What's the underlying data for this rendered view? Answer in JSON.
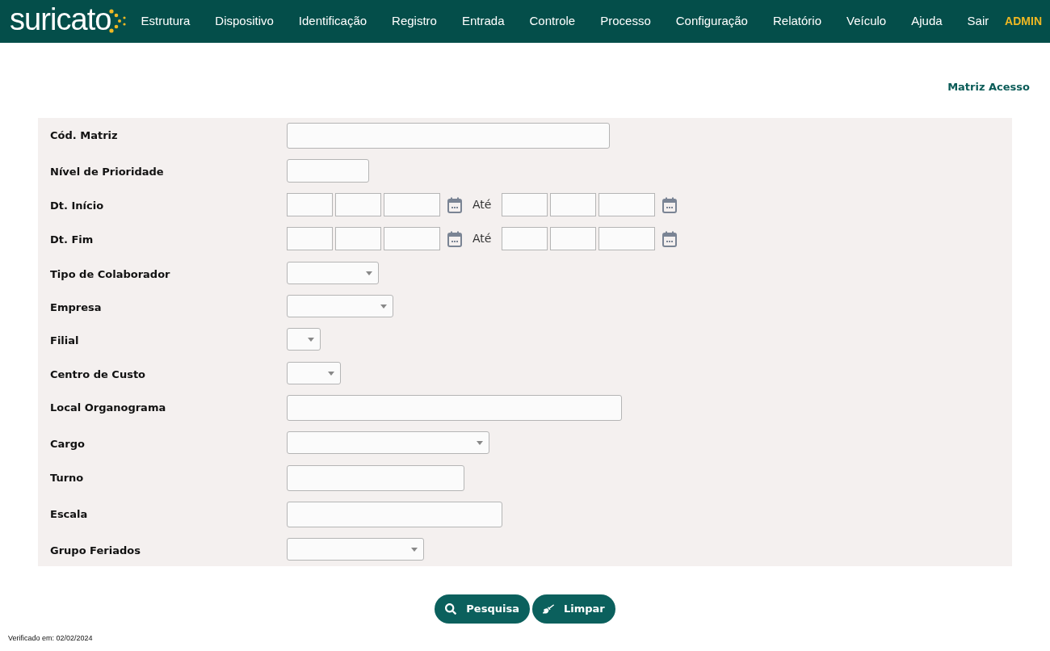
{
  "header": {
    "logo": "suricato",
    "menu": [
      {
        "label": "Estrutura"
      },
      {
        "label": "Dispositivo"
      },
      {
        "label": "Identificação"
      },
      {
        "label": "Registro"
      },
      {
        "label": "Entrada"
      },
      {
        "label": "Controle"
      },
      {
        "label": "Processo"
      },
      {
        "label": "Configuração"
      },
      {
        "label": "Relatório"
      },
      {
        "label": "Veículo"
      },
      {
        "label": "Ajuda"
      },
      {
        "label": "Sair"
      }
    ],
    "user": "ADMIN"
  },
  "page_title": "Matriz Acesso",
  "fields": [
    {
      "label": "Cód. Matriz",
      "kind": "text"
    },
    {
      "label": "Nível de Prioridade",
      "kind": "text"
    },
    {
      "label": "Dt. Início",
      "kind": "date_range",
      "separator": "Até"
    },
    {
      "label": "Dt. Fim",
      "kind": "date_range",
      "separator": "Até"
    },
    {
      "label": "Tipo de Colaborador",
      "kind": "select"
    },
    {
      "label": "Empresa",
      "kind": "select"
    },
    {
      "label": "Filial",
      "kind": "select"
    },
    {
      "label": "Centro de Custo",
      "kind": "select"
    },
    {
      "label": "Local Organograma",
      "kind": "text"
    },
    {
      "label": "Cargo",
      "kind": "select"
    },
    {
      "label": "Turno",
      "kind": "text"
    },
    {
      "label": "Escala",
      "kind": "text"
    },
    {
      "label": "Grupo Feriados",
      "kind": "select"
    }
  ],
  "buttons": [
    {
      "label": "Pesquisa"
    },
    {
      "label": "Limpar"
    }
  ],
  "footer": "Verificado em: 02/02/2024"
}
